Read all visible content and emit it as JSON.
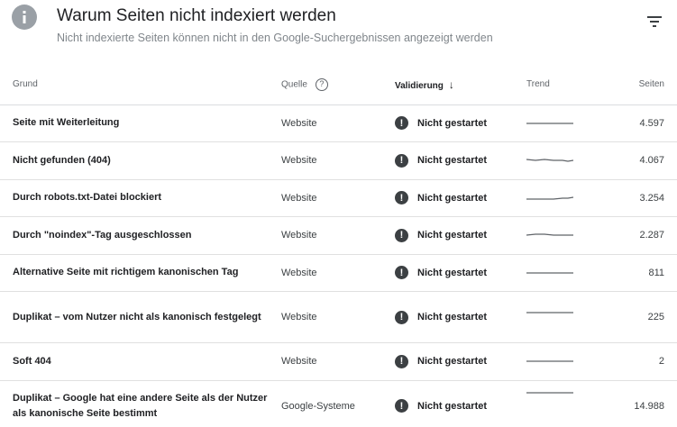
{
  "header": {
    "title": "Warum Seiten nicht indexiert werden",
    "subtitle": "Nicht indexierte Seiten können nicht in den Google-Suchergebnissen angezeigt werden",
    "info_icon": "info-icon",
    "filter_icon": "filter-icon"
  },
  "table": {
    "columns": {
      "reason": "Grund",
      "source": "Quelle",
      "validation": "Validierung",
      "trend": "Trend",
      "pages": "Seiten"
    },
    "rows": [
      {
        "reason": "Seite mit Weiterleitung",
        "source": "Website",
        "status": "Nicht gestartet",
        "pages": "4.597"
      },
      {
        "reason": "Nicht gefunden (404)",
        "source": "Website",
        "status": "Nicht gestartet",
        "pages": "4.067"
      },
      {
        "reason": "Durch robots.txt-Datei blockiert",
        "source": "Website",
        "status": "Nicht gestartet",
        "pages": "3.254"
      },
      {
        "reason": "Durch \"noindex\"-Tag ausgeschlossen",
        "source": "Website",
        "status": "Nicht gestartet",
        "pages": "2.287"
      },
      {
        "reason": "Alternative Seite mit richtigem kanonischen Tag",
        "source": "Website",
        "status": "Nicht gestartet",
        "pages": "811"
      },
      {
        "reason": "Duplikat – vom Nutzer nicht als kanonisch festgelegt",
        "source": "Website",
        "status": "Nicht gestartet",
        "pages": "225"
      },
      {
        "reason": "Soft 404",
        "source": "Website",
        "status": "Nicht gestartet",
        "pages": "2"
      },
      {
        "reason": "Duplikat – Google hat eine andere Seite als der Nutzer als kanonische Seite bestimmt",
        "source": "Google-Systeme",
        "status": "Nicht gestartet",
        "pages": "14.988"
      }
    ]
  },
  "colors": {
    "status_icon": "#3c4043",
    "info_icon": "#9aa0a6",
    "trend_line": "#5f6368"
  }
}
